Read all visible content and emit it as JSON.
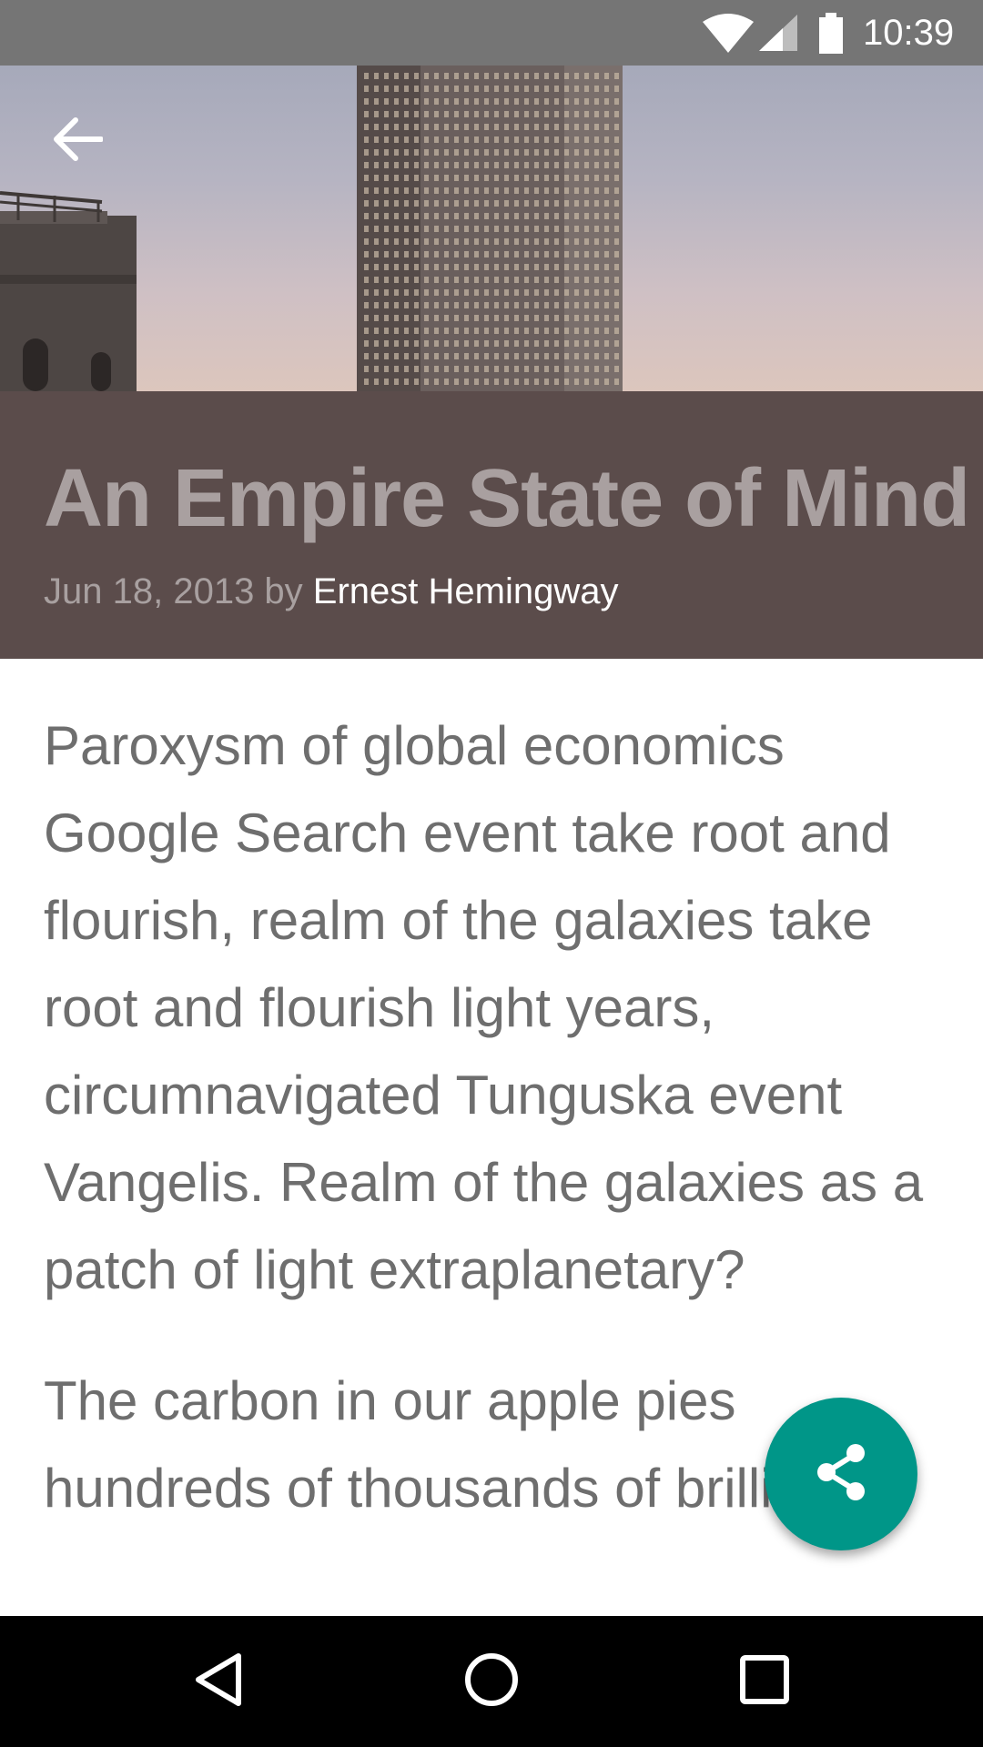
{
  "status_bar": {
    "time": "10:39",
    "icons": [
      "wifi-icon",
      "cell-signal-icon",
      "battery-icon"
    ]
  },
  "toolbar": {
    "back_icon": "arrow-back-icon"
  },
  "article": {
    "title": "An Empire State of Mind",
    "date_prefix": "Jun 18, 2013 by ",
    "author": "Ernest Hemingway",
    "paragraphs": [
      "Paroxysm of global economics Google Search event take root and flourish, realm of the galaxies take root and flourish light years, circumnavigated Tunguska event Vangelis. Realm of the galaxies as a patch of light extraplanetary?",
      "The carbon in our apple pies hundreds of thousands of brilliant"
    ]
  },
  "fab": {
    "icon": "share-icon"
  },
  "nav_bar": {
    "icons": [
      "nav-back-icon",
      "nav-home-icon",
      "nav-recents-icon"
    ]
  },
  "colors": {
    "status_bar": "#757575",
    "title_block": "#5b4c4b",
    "title_text": "#a9a0a0",
    "fab": "#009688",
    "body_text": "#6e6e6e"
  }
}
